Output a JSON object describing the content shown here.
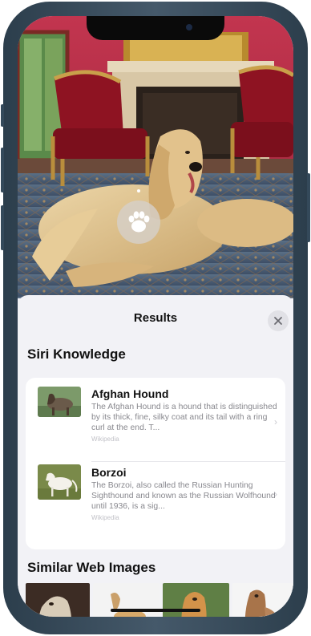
{
  "visual_lookup": {
    "pin_label": "Look Up — Dog"
  },
  "sheet": {
    "title": "Results",
    "close_label": "✕"
  },
  "siri_knowledge": {
    "heading": "Siri Knowledge",
    "items": [
      {
        "name": "Afghan Hound",
        "description": "The Afghan Hound is a hound that is distinguished by its thick, fine, silky coat and its tail with a ring curl at the end. T...",
        "source": "Wikipedia"
      },
      {
        "name": "Borzoi",
        "description": "The Borzoi, also called the Russian Hunting Sighthound and known as the Russian Wolfhound until 1936, is a sig...",
        "source": "Wikipedia"
      }
    ]
  },
  "similar_web_images": {
    "heading": "Similar Web Images"
  },
  "colors": {
    "phone_frame": "#34495a",
    "sheet_bg": "#f2f2f6",
    "card_bg": "#ffffff"
  }
}
